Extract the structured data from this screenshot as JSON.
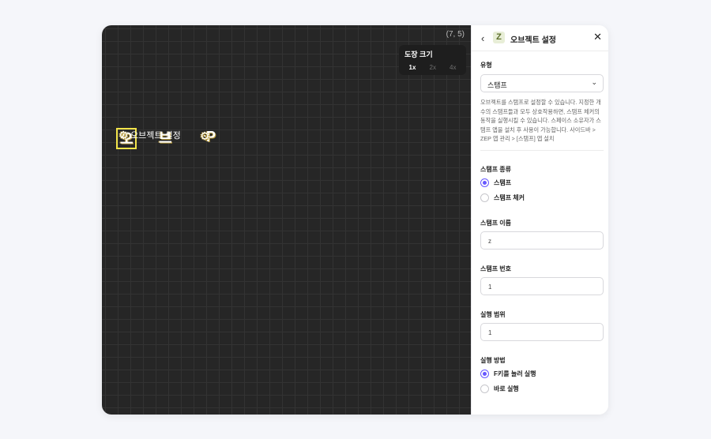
{
  "canvas": {
    "coords": "(7, 5)",
    "zoom_title": "도장 크기",
    "zoom_options": [
      "1x",
      "2x",
      "4x"
    ],
    "zoom_selected": "1x",
    "object_label": "오브젝트 설정",
    "tiles": [
      "오",
      "브",
      "P"
    ]
  },
  "panel": {
    "title": "오브젝트 설정",
    "header_icon": "Z",
    "type_label": "유형",
    "type_value": "스탬프",
    "description": "오브젝트를 스탬프로 설정할 수 있습니다. 지정한 개수의 스탬프들과 모두 상호작용하면, 스탬프 체커의 동작을 실행시킬 수 있습니다. 스페이스 소유자가 스탬프 앱을 설치 후 사용이 가능합니다. 사이드바 > ZEP 앱 관리 > [스탬프] 앱 설치",
    "stamp_kind_label": "스탬프 종류",
    "stamp_kind_options": [
      "스탬프",
      "스탬프 체커"
    ],
    "stamp_kind_selected": "스탬프",
    "stamp_name_label": "스탬프 이름",
    "stamp_name_value": "z",
    "stamp_number_label": "스탬프 번호",
    "stamp_number_value": "1",
    "range_label": "실행 범위",
    "range_value": "1",
    "method_label": "실행 방법",
    "method_options": [
      "F키를 눌러 실행",
      "바로 실행"
    ],
    "method_selected": "F키를 눌러 실행"
  },
  "colors": {
    "accent": "#6758ff",
    "canvas_bg": "#262626",
    "selection": "#f2e44a"
  },
  "icons": [
    "back-chevron-icon",
    "z-logo-icon",
    "close-icon",
    "chevron-down-icon",
    "gear-icon"
  ]
}
